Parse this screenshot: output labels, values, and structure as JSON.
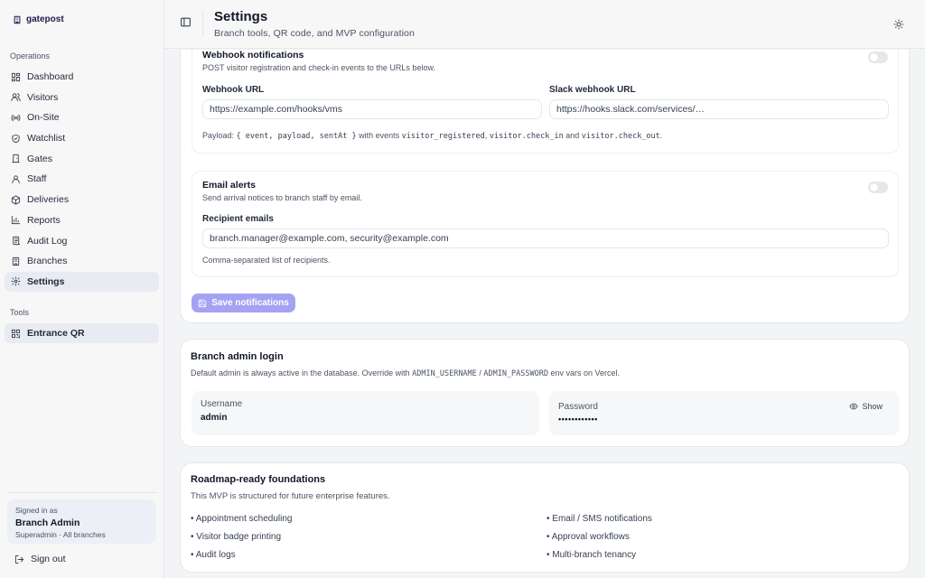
{
  "brand": {
    "name": "gatepost"
  },
  "sidebar": {
    "operations_label": "Operations",
    "items": [
      {
        "label": "Dashboard",
        "icon": "dashboard-icon"
      },
      {
        "label": "Visitors",
        "icon": "users-icon"
      },
      {
        "label": "On-Site",
        "icon": "radio-icon"
      },
      {
        "label": "Watchlist",
        "icon": "shield-icon"
      },
      {
        "label": "Gates",
        "icon": "door-icon"
      },
      {
        "label": "Staff",
        "icon": "user-icon"
      },
      {
        "label": "Deliveries",
        "icon": "package-icon"
      },
      {
        "label": "Reports",
        "icon": "bar-chart-icon"
      },
      {
        "label": "Audit Log",
        "icon": "log-icon"
      },
      {
        "label": "Branches",
        "icon": "building-icon"
      },
      {
        "label": "Settings",
        "icon": "gear-icon",
        "active": true
      }
    ],
    "tools_label": "Tools",
    "tools": [
      {
        "label": "Entrance QR",
        "icon": "qr-icon"
      }
    ],
    "signed_in": {
      "label": "Signed in as",
      "name": "Branch Admin",
      "role": "Superadmin · All branches"
    },
    "sign_out": "Sign out"
  },
  "header": {
    "title": "Settings",
    "subtitle": "Branch tools, QR code, and MVP configuration"
  },
  "notifications": {
    "webhook": {
      "title": "Webhook notifications",
      "description": "POST visitor registration and check-in events to the URLs below.",
      "enabled": false,
      "webhook_url_label": "Webhook URL",
      "webhook_url_value": "https://example.com/hooks/vms",
      "slack_url_label": "Slack webhook URL",
      "slack_url_value": "https://hooks.slack.com/services/…",
      "payload_prefix": "Payload:",
      "payload_code": "{ event, payload, sentAt }",
      "payload_mid": "with events",
      "event_1": "visitor_registered",
      "sep_1": ",",
      "event_2": "visitor.check_in",
      "and": "and",
      "event_3": "visitor.check_out",
      "end": "."
    },
    "email": {
      "title": "Email alerts",
      "description": "Send arrival notices to branch staff by email.",
      "enabled": false,
      "recipients_label": "Recipient emails",
      "recipients_value": "branch.manager@example.com, security@example.com",
      "hint": "Comma-separated list of recipients."
    },
    "save_label": "Save notifications"
  },
  "admin_login": {
    "title": "Branch admin login",
    "desc_prefix": "Default admin is always active in the database. Override with",
    "env_user": "ADMIN_USERNAME",
    "slash": "/",
    "env_pass": "ADMIN_PASSWORD",
    "desc_suffix": "env vars on Vercel.",
    "username_label": "Username",
    "username_value": "admin",
    "password_label": "Password",
    "password_value": "••••••••••••",
    "show_label": "Show"
  },
  "roadmap": {
    "title": "Roadmap-ready foundations",
    "description": "This MVP is structured for future enterprise features.",
    "items": [
      "• Appointment scheduling",
      "• Email / SMS notifications",
      "• Visitor badge printing",
      "• Approval workflows",
      "• Audit logs",
      "• Multi-branch tenancy"
    ]
  },
  "colors": {
    "accent": "#a5a2f3",
    "active_nav": "#e9ebf2",
    "brand": "#1e1b4b"
  }
}
